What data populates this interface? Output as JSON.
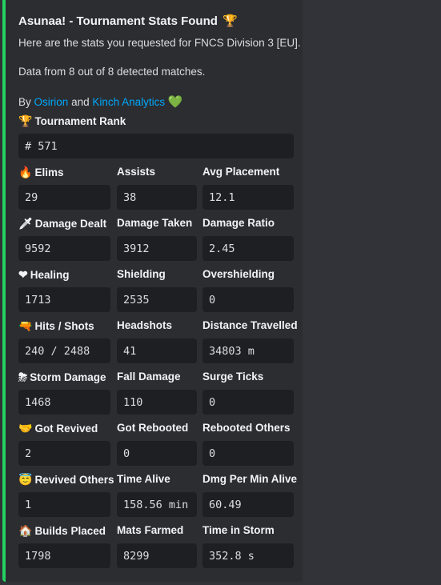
{
  "embed": {
    "title": "Asunaa! - Tournament Stats Found",
    "title_emoji": "🏆",
    "accent_color": "#23d160",
    "line1": "Here are the stats you requested for FNCS Division 3 [EU].",
    "line2": "Data from 8 out of 8 detected matches.",
    "by_prefix": "By",
    "by_link1": "Osirion",
    "by_and": "and",
    "by_link2": "Kinch Analytics",
    "by_emoji": "💚"
  },
  "rank": {
    "label": "Tournament Rank",
    "emoji": "🏆",
    "value": "# 571"
  },
  "rows": [
    {
      "fields": [
        {
          "label": "Elims",
          "emoji": "🔥",
          "value": "29"
        },
        {
          "label": "Assists",
          "emoji": "",
          "value": "38"
        },
        {
          "label": "Avg Placement",
          "emoji": "",
          "value": "12.1"
        }
      ]
    },
    {
      "fields": [
        {
          "label": "Damage Dealt",
          "emoji": "🗡",
          "value": "9592"
        },
        {
          "label": "Damage Taken",
          "emoji": "",
          "value": "3912"
        },
        {
          "label": "Damage Ratio",
          "emoji": "",
          "value": "2.45"
        }
      ]
    },
    {
      "fields": [
        {
          "label": "Healing",
          "emoji": "❤",
          "value": "1713"
        },
        {
          "label": "Shielding",
          "emoji": "",
          "value": "2535"
        },
        {
          "label": "Overshielding",
          "emoji": "",
          "value": "0"
        }
      ]
    },
    {
      "fields": [
        {
          "label": "Hits / Shots",
          "emoji": "🔫",
          "value": "240 / 2488"
        },
        {
          "label": "Headshots",
          "emoji": "",
          "value": "41"
        },
        {
          "label": "Distance Travelled",
          "emoji": "",
          "value": "34803 m"
        }
      ]
    },
    {
      "fields": [
        {
          "label": "Storm Damage",
          "emoji": "⛈",
          "value": "1468"
        },
        {
          "label": "Fall Damage",
          "emoji": "",
          "value": "110"
        },
        {
          "label": "Surge Ticks",
          "emoji": "",
          "value": "0"
        }
      ]
    },
    {
      "fields": [
        {
          "label": "Got Revived",
          "emoji": "🤝",
          "value": "2"
        },
        {
          "label": "Got Rebooted",
          "emoji": "",
          "value": "0"
        },
        {
          "label": "Rebooted Others",
          "emoji": "",
          "value": "0"
        }
      ]
    },
    {
      "fields": [
        {
          "label": "Revived Others",
          "emoji": "😇",
          "value": "1"
        },
        {
          "label": "Time Alive",
          "emoji": "",
          "value": "158.56 min"
        },
        {
          "label": "Dmg Per Min Alive",
          "emoji": "",
          "value": "60.49"
        }
      ]
    },
    {
      "fields": [
        {
          "label": "Builds Placed",
          "emoji": "🏠",
          "value": "1798"
        },
        {
          "label": "Mats Farmed",
          "emoji": "",
          "value": "8299"
        },
        {
          "label": "Time in Storm",
          "emoji": "",
          "value": "352.8 s"
        }
      ]
    }
  ]
}
